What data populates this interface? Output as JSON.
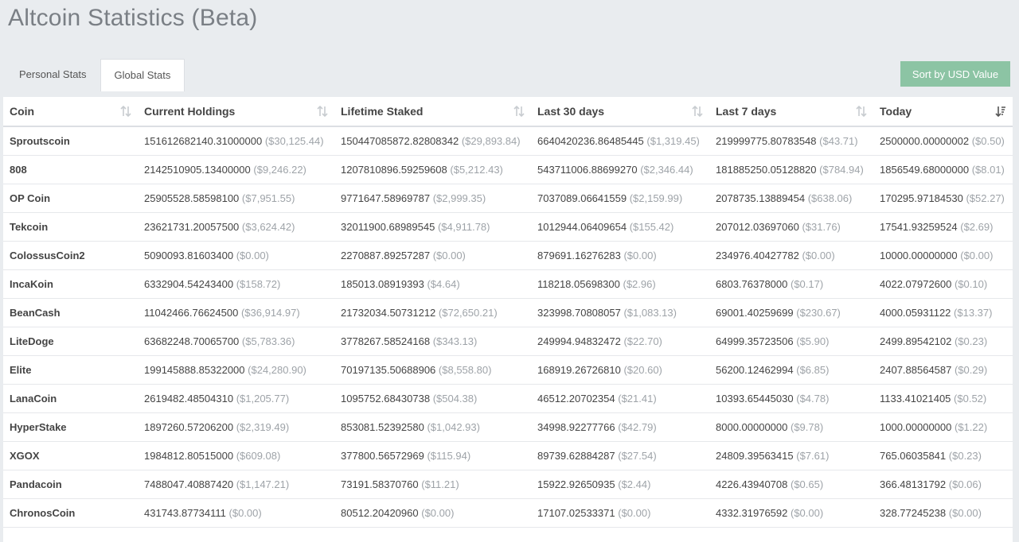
{
  "page": {
    "title": "Altcoin Statistics (Beta)"
  },
  "tabs": [
    {
      "label": "Personal Stats",
      "active": false
    },
    {
      "label": "Global Stats",
      "active": true
    }
  ],
  "sort_button": {
    "label": "Sort by USD Value",
    "color": "#8cc4a4"
  },
  "table": {
    "columns": [
      "Coin",
      "Current Holdings",
      "Lifetime Staked",
      "Last 30 days",
      "Last 7 days",
      "Today"
    ],
    "rows": [
      {
        "coin": "Sproutscoin",
        "cells": [
          [
            "151612682140.31000000",
            "($30,125.44)"
          ],
          [
            "150447085872.82808342",
            "($29,893.84)"
          ],
          [
            "6640420236.86485445",
            "($1,319.45)"
          ],
          [
            "219999775.80783548",
            "($43.71)"
          ],
          [
            "2500000.00000002",
            "($0.50)"
          ]
        ]
      },
      {
        "coin": "808",
        "cells": [
          [
            "2142510905.13400000",
            "($9,246.22)"
          ],
          [
            "1207810896.59259608",
            "($5,212.43)"
          ],
          [
            "543711006.88699270",
            "($2,346.44)"
          ],
          [
            "181885250.05128820",
            "($784.94)"
          ],
          [
            "1856549.68000000",
            "($8.01)"
          ]
        ]
      },
      {
        "coin": "OP Coin",
        "cells": [
          [
            "25905528.58598100",
            "($7,951.55)"
          ],
          [
            "9771647.58969787",
            "($2,999.35)"
          ],
          [
            "7037089.06641559",
            "($2,159.99)"
          ],
          [
            "2078735.13889454",
            "($638.06)"
          ],
          [
            "170295.97184530",
            "($52.27)"
          ]
        ]
      },
      {
        "coin": "Tekcoin",
        "cells": [
          [
            "23621731.20057500",
            "($3,624.42)"
          ],
          [
            "32011900.68989545",
            "($4,911.78)"
          ],
          [
            "1012944.06409654",
            "($155.42)"
          ],
          [
            "207012.03697060",
            "($31.76)"
          ],
          [
            "17541.93259524",
            "($2.69)"
          ]
        ]
      },
      {
        "coin": "ColossusCoin2",
        "cells": [
          [
            "5090093.81603400",
            "($0.00)"
          ],
          [
            "2270887.89257287",
            "($0.00)"
          ],
          [
            "879691.16276283",
            "($0.00)"
          ],
          [
            "234976.40427782",
            "($0.00)"
          ],
          [
            "10000.00000000",
            "($0.00)"
          ]
        ]
      },
      {
        "coin": "IncaKoin",
        "cells": [
          [
            "6332904.54243400",
            "($158.72)"
          ],
          [
            "185013.08919393",
            "($4.64)"
          ],
          [
            "118218.05698300",
            "($2.96)"
          ],
          [
            "6803.76378000",
            "($0.17)"
          ],
          [
            "4022.07972600",
            "($0.10)"
          ]
        ]
      },
      {
        "coin": "BeanCash",
        "cells": [
          [
            "11042466.76624500",
            "($36,914.97)"
          ],
          [
            "21732034.50731212",
            "($72,650.21)"
          ],
          [
            "323998.70808057",
            "($1,083.13)"
          ],
          [
            "69001.40259699",
            "($230.67)"
          ],
          [
            "4000.05931122",
            "($13.37)"
          ]
        ]
      },
      {
        "coin": "LiteDoge",
        "cells": [
          [
            "63682248.70065700",
            "($5,783.36)"
          ],
          [
            "3778267.58524168",
            "($343.13)"
          ],
          [
            "249994.94832472",
            "($22.70)"
          ],
          [
            "64999.35723506",
            "($5.90)"
          ],
          [
            "2499.89542102",
            "($0.23)"
          ]
        ]
      },
      {
        "coin": "Elite",
        "cells": [
          [
            "199145888.85322000",
            "($24,280.90)"
          ],
          [
            "70197135.50688906",
            "($8,558.80)"
          ],
          [
            "168919.26726810",
            "($20.60)"
          ],
          [
            "56200.12462994",
            "($6.85)"
          ],
          [
            "2407.88564587",
            "($0.29)"
          ]
        ]
      },
      {
        "coin": "LanaCoin",
        "cells": [
          [
            "2619482.48504310",
            "($1,205.77)"
          ],
          [
            "1095752.68430738",
            "($504.38)"
          ],
          [
            "46512.20702354",
            "($21.41)"
          ],
          [
            "10393.65445030",
            "($4.78)"
          ],
          [
            "1133.41021405",
            "($0.52)"
          ]
        ]
      },
      {
        "coin": "HyperStake",
        "cells": [
          [
            "1897260.57206200",
            "($2,319.49)"
          ],
          [
            "853081.52392580",
            "($1,042.93)"
          ],
          [
            "34998.92277766",
            "($42.79)"
          ],
          [
            "8000.00000000",
            "($9.78)"
          ],
          [
            "1000.00000000",
            "($1.22)"
          ]
        ]
      },
      {
        "coin": "XGOX",
        "cells": [
          [
            "1984812.80515000",
            "($609.08)"
          ],
          [
            "377800.56572969",
            "($115.94)"
          ],
          [
            "89739.62884287",
            "($27.54)"
          ],
          [
            "24809.39563415",
            "($7.61)"
          ],
          [
            "765.06035841",
            "($0.23)"
          ]
        ]
      },
      {
        "coin": "Pandacoin",
        "cells": [
          [
            "7488047.40887420",
            "($1,147.21)"
          ],
          [
            "73191.58370760",
            "($11.21)"
          ],
          [
            "15922.92650935",
            "($2.44)"
          ],
          [
            "4226.43940708",
            "($0.65)"
          ],
          [
            "366.48131792",
            "($0.06)"
          ]
        ]
      },
      {
        "coin": "ChronosCoin",
        "cells": [
          [
            "431743.87734111",
            "($0.00)"
          ],
          [
            "80512.20420960",
            "($0.00)"
          ],
          [
            "17107.02533371",
            "($0.00)"
          ],
          [
            "4332.31976592",
            "($0.00)"
          ],
          [
            "328.77245238",
            "($0.00)"
          ]
        ]
      }
    ]
  },
  "icons": {
    "sortable": "sort-both-icon",
    "sorted": "sort-desc-icon"
  },
  "colors": {
    "background": "#e9ecef",
    "title": "#7a7f85",
    "usd_text": "#9ea3a8"
  }
}
